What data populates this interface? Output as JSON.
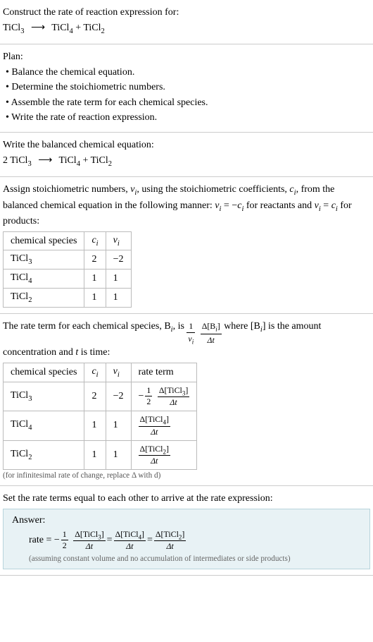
{
  "s1": {
    "title": "Construct the rate of reaction expression for:",
    "eq_lhs": "TiCl",
    "eq_lhs_sub": "3",
    "arrow": "⟶",
    "eq_r1": "TiCl",
    "eq_r1_sub": "4",
    "plus": " + ",
    "eq_r2": "TiCl",
    "eq_r2_sub": "2"
  },
  "s2": {
    "title": "Plan:",
    "b1": "• Balance the chemical equation.",
    "b2": "• Determine the stoichiometric numbers.",
    "b3": "• Assemble the rate term for each chemical species.",
    "b4": "• Write the rate of reaction expression."
  },
  "s3": {
    "title": "Write the balanced chemical equation:",
    "coef": "2 ",
    "lhs": "TiCl",
    "lhs_sub": "3",
    "arrow": "⟶",
    "r1": "TiCl",
    "r1_sub": "4",
    "plus": " + ",
    "r2": "TiCl",
    "r2_sub": "2"
  },
  "s4": {
    "intro1": "Assign stoichiometric numbers, ",
    "nu_i": "ν",
    "nu_i_sub": "i",
    "intro2": ", using the stoichiometric coefficients, ",
    "c_i": "c",
    "c_i_sub": "i",
    "intro3": ", from the balanced chemical equation in the following manner: ",
    "rel1a": "ν",
    "rel1a_sub": "i",
    "rel1b": " = −",
    "rel1c": "c",
    "rel1c_sub": "i",
    "intro4": " for reactants and ",
    "rel2a": "ν",
    "rel2a_sub": "i",
    "rel2b": " = ",
    "rel2c": "c",
    "rel2c_sub": "i",
    "intro5": " for products:",
    "table": {
      "h1": "chemical species",
      "h2": "c",
      "h2_sub": "i",
      "h3": "ν",
      "h3_sub": "i",
      "rows": [
        {
          "sp": "TiCl",
          "sp_sub": "3",
          "c": "2",
          "nu": "−2"
        },
        {
          "sp": "TiCl",
          "sp_sub": "4",
          "c": "1",
          "nu": "1"
        },
        {
          "sp": "TiCl",
          "sp_sub": "2",
          "c": "1",
          "nu": "1"
        }
      ]
    }
  },
  "s5": {
    "p1": "The rate term for each chemical species, B",
    "p1_sub": "i",
    "p2": ", is ",
    "f1_num": "1",
    "f1_den_a": "ν",
    "f1_den_sub": "i",
    "f2_num": "Δ[B",
    "f2_num_sub": "i",
    "f2_num_end": "]",
    "f2_den": "Δt",
    "p3": " where [B",
    "p3_sub": "i",
    "p4": "] is the amount concentration and ",
    "p5": "t",
    "p6": " is time:",
    "table": {
      "h1": "chemical species",
      "h2": "c",
      "h2_sub": "i",
      "h3": "ν",
      "h3_sub": "i",
      "h4": "rate term",
      "rows": [
        {
          "sp": "TiCl",
          "sp_sub": "3",
          "c": "2",
          "nu": "−2",
          "neg": "− ",
          "f1n": "1",
          "f1d": "2",
          "f2n": "Δ[TiCl",
          "f2n_sub": "3",
          "f2n_end": "]",
          "f2d": "Δt"
        },
        {
          "sp": "TiCl",
          "sp_sub": "4",
          "c": "1",
          "nu": "1",
          "neg": "",
          "f1n": "",
          "f1d": "",
          "f2n": "Δ[TiCl",
          "f2n_sub": "4",
          "f2n_end": "]",
          "f2d": "Δt"
        },
        {
          "sp": "TiCl",
          "sp_sub": "2",
          "c": "1",
          "nu": "1",
          "neg": "",
          "f1n": "",
          "f1d": "",
          "f2n": "Δ[TiCl",
          "f2n_sub": "2",
          "f2n_end": "]",
          "f2d": "Δt"
        }
      ]
    },
    "note": "(for infinitesimal rate of change, replace Δ with d)"
  },
  "s6": {
    "title": "Set the rate terms equal to each other to arrive at the rate expression:"
  },
  "answer": {
    "label": "Answer:",
    "rate": "rate = − ",
    "f1n": "1",
    "f1d": "2",
    "t1n": "Δ[TiCl",
    "t1n_sub": "3",
    "t1n_end": "]",
    "t1d": "Δt",
    "eq": " = ",
    "t2n": "Δ[TiCl",
    "t2n_sub": "4",
    "t2n_end": "]",
    "t2d": "Δt",
    "t3n": "Δ[TiCl",
    "t3n_sub": "2",
    "t3n_end": "]",
    "t3d": "Δt",
    "note": "(assuming constant volume and no accumulation of intermediates or side products)"
  }
}
